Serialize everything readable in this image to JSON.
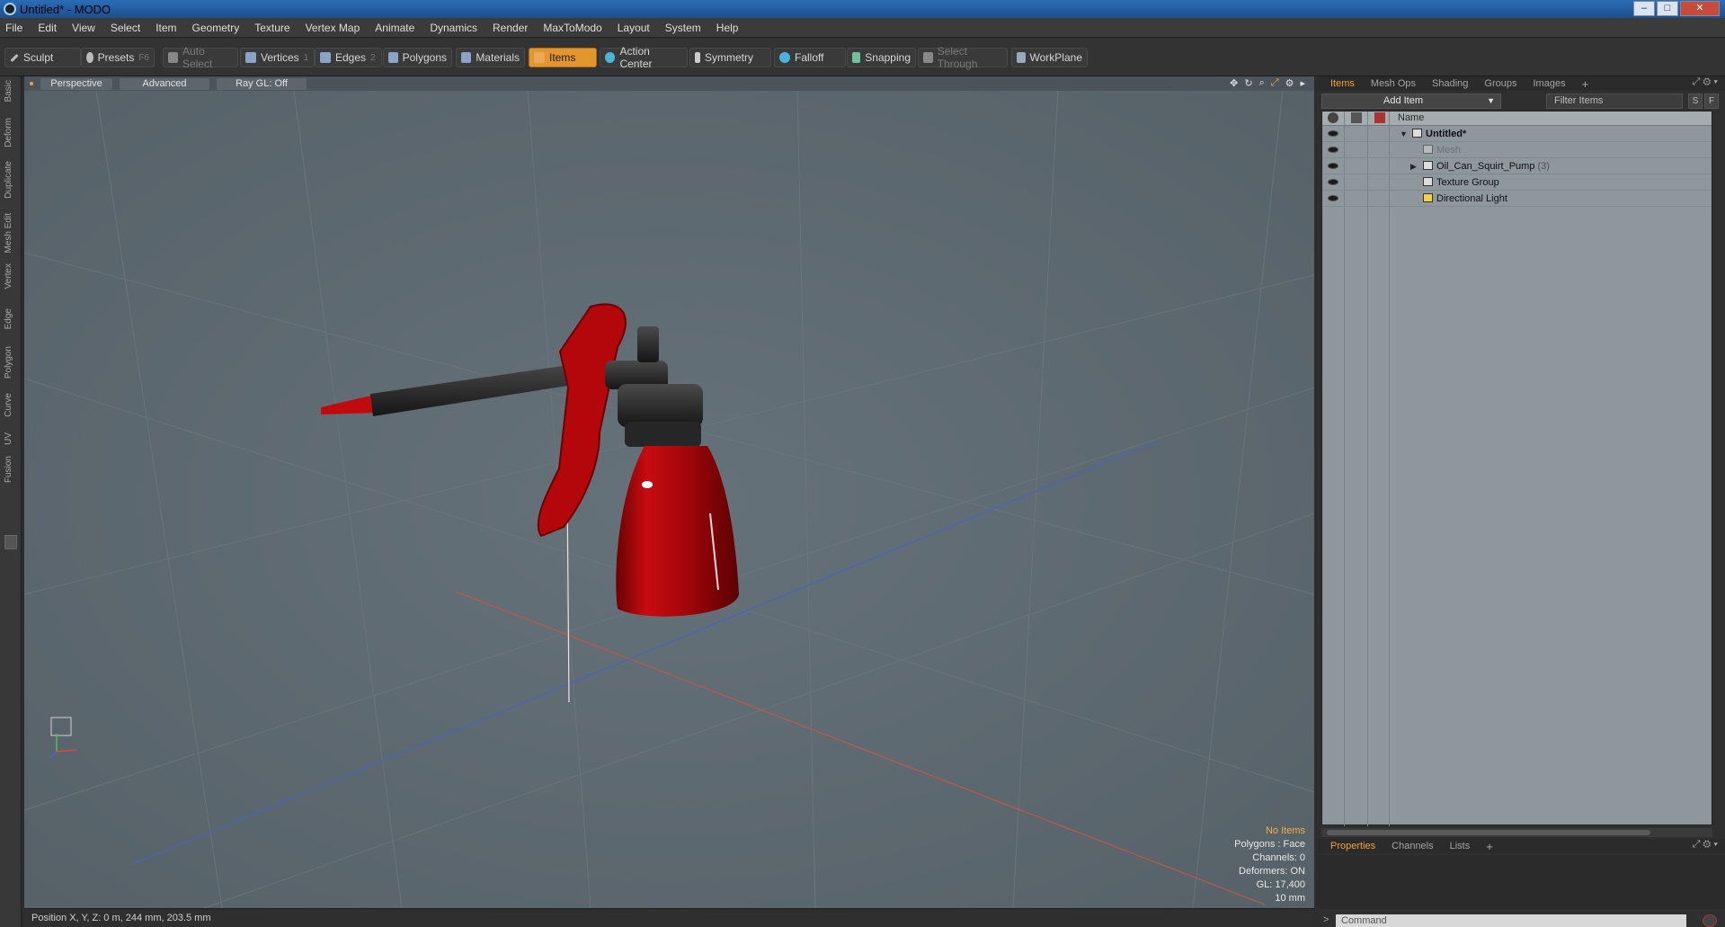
{
  "window": {
    "title": "Untitled* - MODO",
    "min_label": "–",
    "max_label": "□",
    "close_label": "✕"
  },
  "menu": [
    "File",
    "Edit",
    "View",
    "Select",
    "Item",
    "Geometry",
    "Texture",
    "Vertex Map",
    "Animate",
    "Dynamics",
    "Render",
    "MaxToModo",
    "Layout",
    "System",
    "Help"
  ],
  "toolbar": {
    "sculpt": "Sculpt",
    "presets": "Presets",
    "presets_key": "F6",
    "auto_select": "Auto Select",
    "vertices": "Vertices",
    "vertices_key": "1",
    "edges": "Edges",
    "edges_key": "2",
    "polygons": "Polygons",
    "materials": "Materials",
    "items": "Items",
    "action_center": "Action Center",
    "symmetry": "Symmetry",
    "falloff": "Falloff",
    "snapping": "Snapping",
    "select_through": "Select Through",
    "workplane": "WorkPlane"
  },
  "left_tabs": [
    "Basic",
    "Deform",
    "Duplicate",
    "Mesh Edit",
    "Vertex",
    "Edge",
    "Polygon",
    "Curve",
    "UV",
    "Fusion"
  ],
  "viewport": {
    "view_mode": "Perspective",
    "shading": "Advanced",
    "raygl": "Ray GL: Off",
    "info": {
      "no_items": "No Items",
      "polygons": "Polygons : Face",
      "channels": "Channels: 0",
      "deformers": "Deformers: ON",
      "gl": "GL: 17,400",
      "scale": "10 mm"
    }
  },
  "status": {
    "position": "Position X, Y, Z:  0 m, 244 mm, 203.5 mm"
  },
  "items_panel": {
    "tabs": [
      "Items",
      "Mesh Ops",
      "Shading",
      "Groups",
      "Images"
    ],
    "add_item": "Add Item",
    "filter_placeholder": "Filter Items",
    "s_label": "S",
    "f_label": "F",
    "column_name": "Name",
    "tree": [
      {
        "label": "Untitled*",
        "count": ""
      },
      {
        "label": "Mesh",
        "count": ""
      },
      {
        "label": "Oil_Can_Squirt_Pump",
        "count": "(3)"
      },
      {
        "label": "Texture Group",
        "count": ""
      },
      {
        "label": "Directional Light",
        "count": ""
      }
    ]
  },
  "props_panel": {
    "tabs": [
      "Properties",
      "Channels",
      "Lists"
    ]
  },
  "command": {
    "placeholder": "Command"
  },
  "colors": {
    "accent": "#e3952e",
    "viewport_bg": "#5f6b72",
    "can_red": "#b5060a"
  }
}
